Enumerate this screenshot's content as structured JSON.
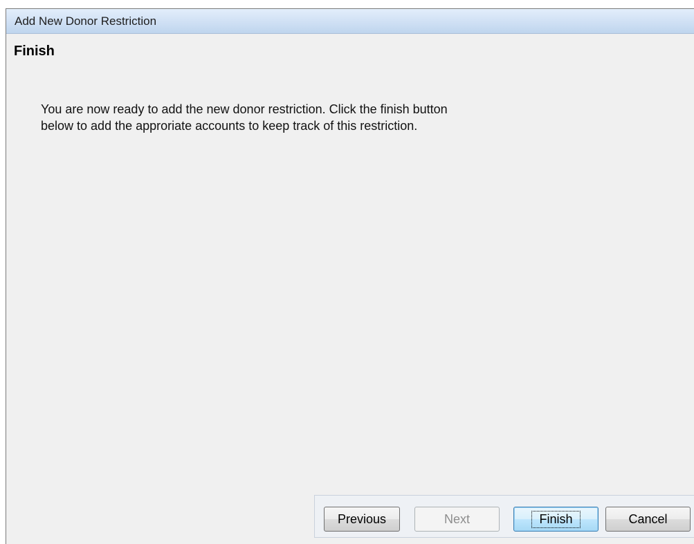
{
  "window": {
    "title": "Add New Donor Restriction"
  },
  "step": {
    "title": "Finish",
    "description_line1": "You are now ready to add the new donor restriction. Click the finish button",
    "description_line2": "below to add the approriate accounts to keep track of this restriction."
  },
  "buttons": {
    "previous": "Previous",
    "next": "Next",
    "finish": "Finish",
    "cancel": "Cancel"
  }
}
